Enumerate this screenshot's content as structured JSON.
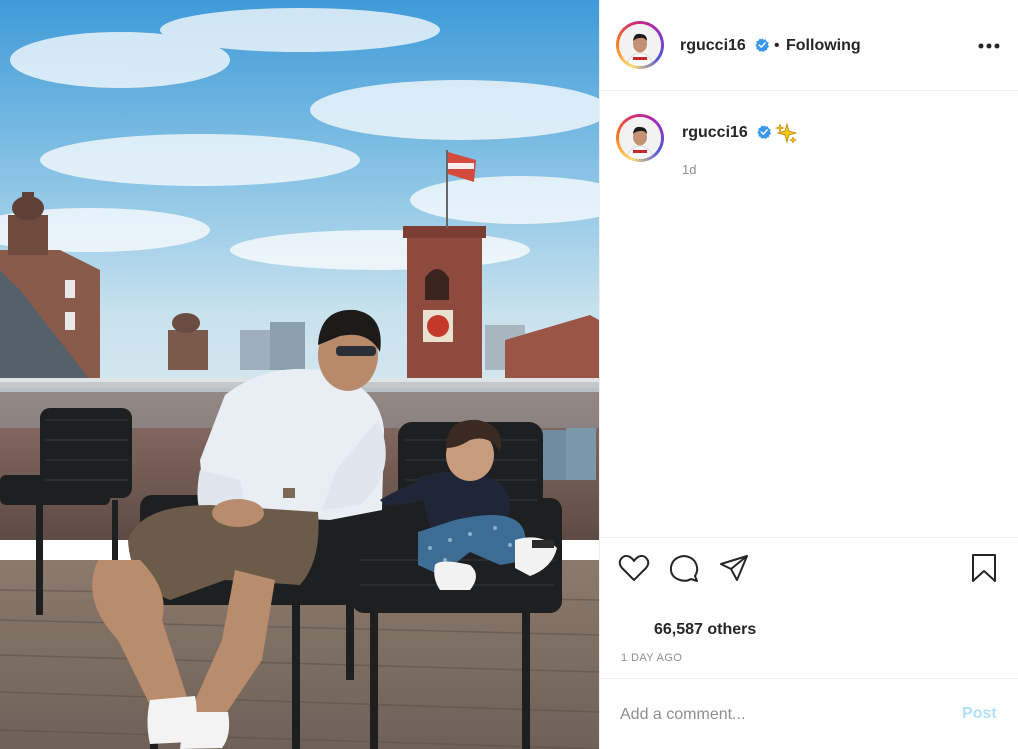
{
  "post": {
    "photo": {
      "subject": "photo-of-man-and-child-on-rooftop-terrace"
    },
    "header": {
      "username": "rgucci16",
      "verified": true,
      "separator": "•",
      "follow_status": "Following",
      "more_icon": "more-horizontal-icon"
    },
    "caption": {
      "username": "rgucci16",
      "verified": true,
      "emoji_icon": "sparkles-icon",
      "age": "1d"
    },
    "actions": {
      "like_icon": "heart-icon",
      "comment_icon": "comment-icon",
      "share_icon": "share-icon",
      "save_icon": "bookmark-icon"
    },
    "likes_text": "66,587 others",
    "post_age": "1 DAY AGO",
    "comment": {
      "placeholder": "Add a comment...",
      "value": "",
      "post_label": "Post"
    },
    "colors": {
      "verified_blue": "#3897f0",
      "post_button_disabled": "#b2dffc",
      "text": "#262626",
      "muted": "#8e8e8e"
    }
  }
}
